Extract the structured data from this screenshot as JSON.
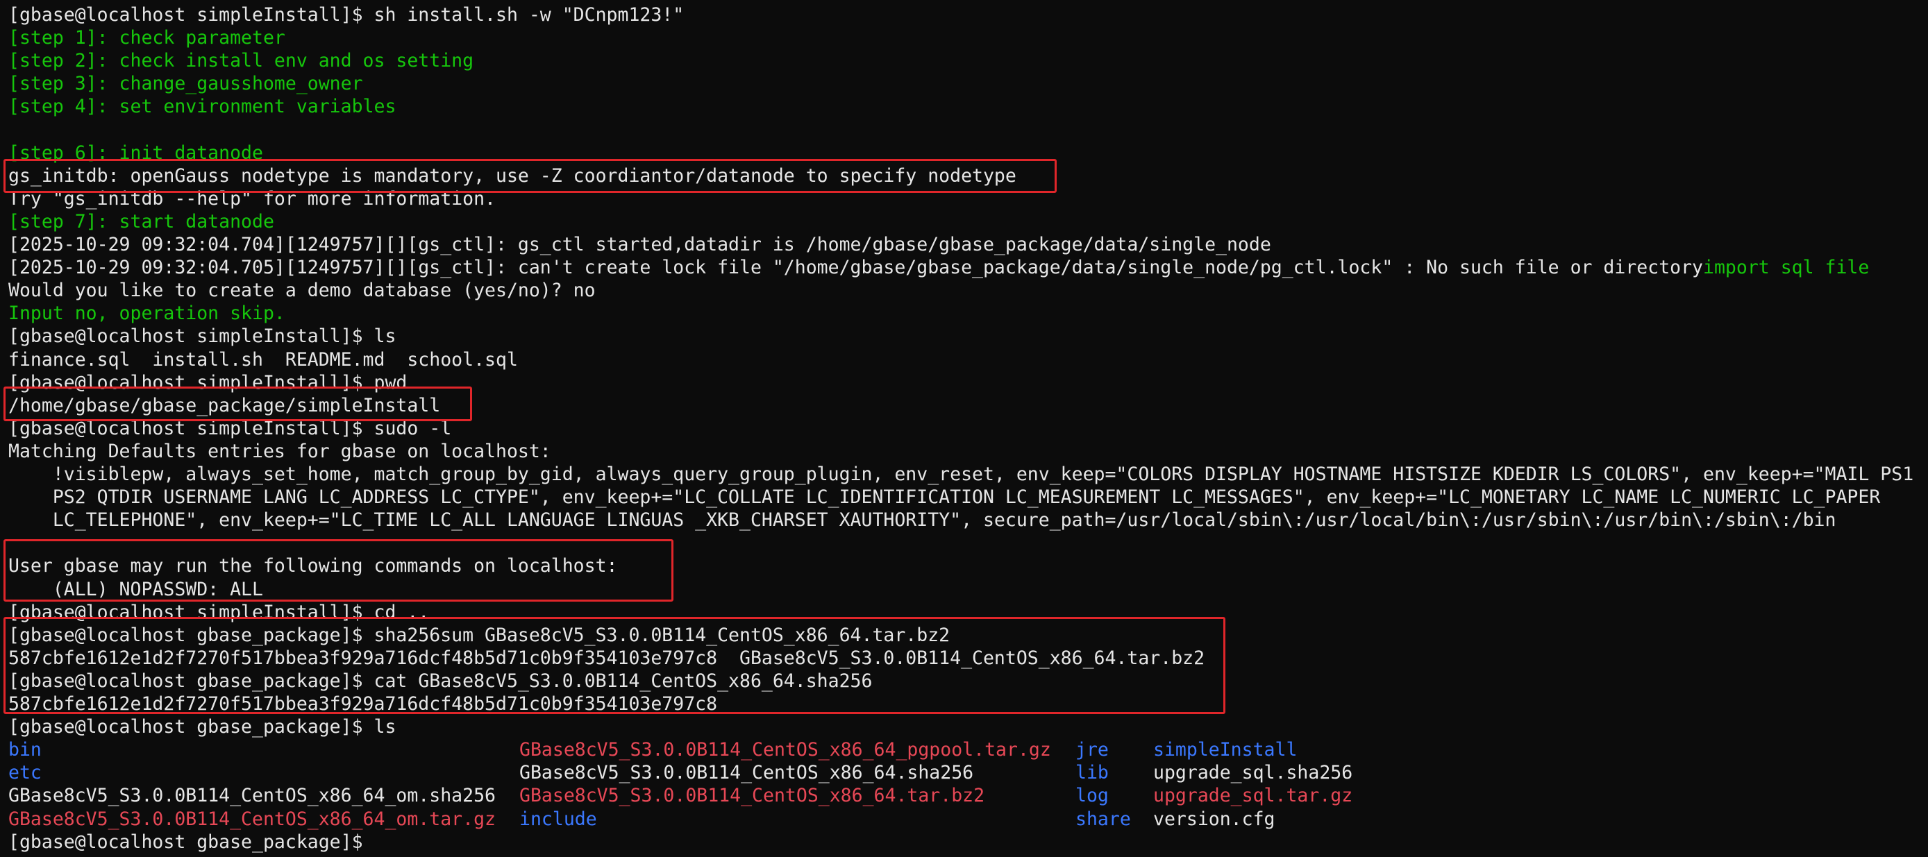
{
  "terminal": {
    "lines": [
      {
        "text": "[gbase@localhost simpleInstall]$ sh install.sh -w \"DCnpm123!\"",
        "color": "#e6e6e6"
      },
      {
        "text": "[step 1]: check parameter",
        "color": "#16c60c"
      },
      {
        "text": "[step 2]: check install env and os setting",
        "color": "#16c60c"
      },
      {
        "text": "[step 3]: change_gausshome_owner",
        "color": "#16c60c"
      },
      {
        "text": "[step 4]: set environment variables",
        "color": "#16c60c"
      },
      {
        "text": "",
        "color": "#e6e6e6"
      },
      {
        "text": "[step 6]: init datanode",
        "color": "#16c60c"
      },
      {
        "text": "gs_initdb: openGauss nodetype is mandatory, use -Z coordiantor/datanode to specify nodetype",
        "color": "#e6e6e6"
      },
      {
        "text": "Try \"gs_initdb --help\" for more information.",
        "color": "#e6e6e6"
      },
      {
        "text": "[step 7]: start datanode",
        "color": "#16c60c"
      },
      {
        "text": "[2025-10-29 09:32:04.704][1249757][][gs_ctl]: gs_ctl started,datadir is /home/gbase/gbase_package/data/single_node",
        "color": "#e6e6e6"
      },
      {
        "text": "[2025-10-29 09:32:04.705][1249757][][gs_ctl]: can't create lock file \"/home/gbase/gbase_package/data/single_node/pg_ctl.lock\" : No such file or directory",
        "color": "#e6e6e6",
        "suffix": "import sql file",
        "suffix_color": "#16c60c"
      },
      {
        "text": "Would you like to create a demo database (yes/no)? no",
        "color": "#e6e6e6"
      },
      {
        "text": "Input no, operation skip.",
        "color": "#16c60c"
      },
      {
        "text": "[gbase@localhost simpleInstall]$ ls",
        "color": "#e6e6e6"
      },
      {
        "text": "finance.sql  install.sh  README.md  school.sql",
        "color": "#e6e6e6"
      },
      {
        "text": "[gbase@localhost simpleInstall]$ pwd",
        "color": "#e6e6e6"
      },
      {
        "text": "/home/gbase/gbase_package/simpleInstall",
        "color": "#e6e6e6"
      },
      {
        "text": "[gbase@localhost simpleInstall]$ sudo -l",
        "color": "#e6e6e6"
      },
      {
        "text": "Matching Defaults entries for gbase on localhost:",
        "color": "#e6e6e6"
      },
      {
        "text": "    !visiblepw, always_set_home, match_group_by_gid, always_query_group_plugin, env_reset, env_keep=\"COLORS DISPLAY HOSTNAME HISTSIZE KDEDIR LS_COLORS\", env_keep+=\"MAIL PS1",
        "color": "#e6e6e6"
      },
      {
        "text": "    PS2 QTDIR USERNAME LANG LC_ADDRESS LC_CTYPE\", env_keep+=\"LC_COLLATE LC_IDENTIFICATION LC_MEASUREMENT LC_MESSAGES\", env_keep+=\"LC_MONETARY LC_NAME LC_NUMERIC LC_PAPER",
        "color": "#e6e6e6"
      },
      {
        "text": "    LC_TELEPHONE\", env_keep+=\"LC_TIME LC_ALL LANGUAGE LINGUAS _XKB_CHARSET XAUTHORITY\", secure_path=/usr/local/sbin\\:/usr/local/bin\\:/usr/sbin\\:/usr/bin\\:/sbin\\:/bin",
        "color": "#e6e6e6"
      },
      {
        "text": "",
        "color": "#e6e6e6"
      },
      {
        "text": "User gbase may run the following commands on localhost:",
        "color": "#e6e6e6"
      },
      {
        "text": "    (ALL) NOPASSWD: ALL",
        "color": "#e6e6e6"
      },
      {
        "text": "[gbase@localhost simpleInstall]$ cd ..",
        "color": "#e6e6e6"
      },
      {
        "text": "[gbase@localhost gbase_package]$ sha256sum GBase8cV5_S3.0.0B114_CentOS_x86_64.tar.bz2",
        "color": "#e6e6e6"
      },
      {
        "text": "587cbfe1612e1d2f7270f517bbea3f929a716dcf48b5d71c0b9f354103e797c8  GBase8cV5_S3.0.0B114_CentOS_x86_64.tar.bz2",
        "color": "#e6e6e6"
      },
      {
        "text": "[gbase@localhost gbase_package]$ cat GBase8cV5_S3.0.0B114_CentOS_x86_64.sha256",
        "color": "#e6e6e6"
      },
      {
        "text": "587cbfe1612e1d2f7270f517bbea3f929a716dcf48b5d71c0b9f354103e797c8",
        "color": "#e6e6e6"
      },
      {
        "text": "[gbase@localhost gbase_package]$ ls",
        "color": "#e6e6e6"
      }
    ],
    "ls_rows": [
      [
        {
          "text": "bin",
          "color": "#3b78ff"
        },
        {
          "text": "GBase8cV5_S3.0.0B114_CentOS_x86_64_pgpool.tar.gz",
          "color": "#e74856"
        },
        {
          "text": "jre",
          "color": "#3b78ff"
        },
        {
          "text": "simpleInstall",
          "color": "#3b78ff"
        }
      ],
      [
        {
          "text": "etc",
          "color": "#3b78ff"
        },
        {
          "text": "GBase8cV5_S3.0.0B114_CentOS_x86_64.sha256",
          "color": "#e6e6e6"
        },
        {
          "text": "lib",
          "color": "#3b78ff"
        },
        {
          "text": "upgrade_sql.sha256",
          "color": "#e6e6e6"
        }
      ],
      [
        {
          "text": "GBase8cV5_S3.0.0B114_CentOS_x86_64_om.sha256",
          "color": "#e6e6e6"
        },
        {
          "text": "GBase8cV5_S3.0.0B114_CentOS_x86_64.tar.bz2",
          "color": "#e74856"
        },
        {
          "text": "log",
          "color": "#3b78ff"
        },
        {
          "text": "upgrade_sql.tar.gz",
          "color": "#e74856"
        }
      ],
      [
        {
          "text": "GBase8cV5_S3.0.0B114_CentOS_x86_64_om.tar.gz",
          "color": "#e74856"
        },
        {
          "text": "include",
          "color": "#3b78ff"
        },
        {
          "text": "share",
          "color": "#3b78ff"
        },
        {
          "text": "version.cfg",
          "color": "#e6e6e6"
        }
      ]
    ],
    "final_prompt": "[gbase@localhost gbase_package]$ ",
    "highlight_color": "#e0262a"
  }
}
